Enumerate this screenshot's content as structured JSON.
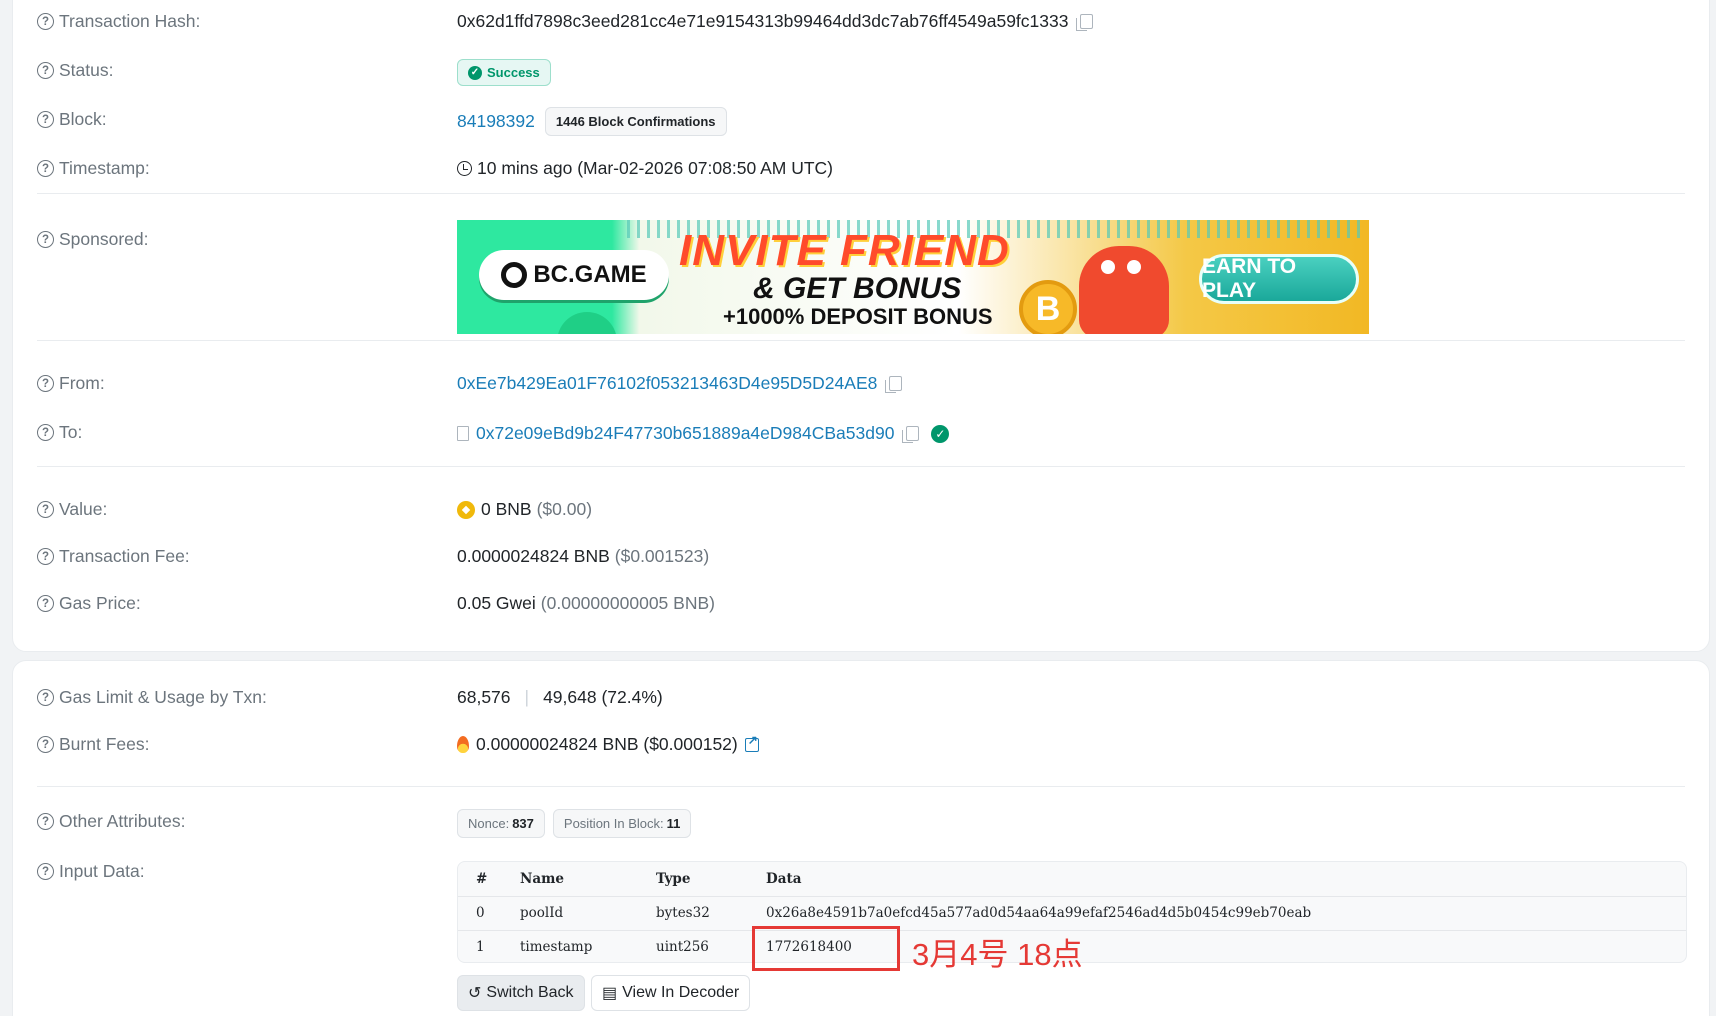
{
  "overview": {
    "tx_hash": {
      "label": "Transaction Hash:",
      "value": "0x62d1ffd7898c3eed281cc4e71e9154313b99464dd3dc7ab76ff4549a59fc1333"
    },
    "status": {
      "label": "Status:",
      "value": "Success"
    },
    "block": {
      "label": "Block:",
      "number": "84198392",
      "confirmations": "1446 Block Confirmations"
    },
    "timestamp": {
      "label": "Timestamp:",
      "value": "10 mins ago (Mar-02-2026 07:08:50 AM UTC)"
    },
    "sponsored": {
      "label": "Sponsored:",
      "banner": {
        "brand": "BC.GAME",
        "headline": "INVITE FRIEND",
        "subline": "& GET BONUS",
        "offer": "+1000% DEPOSIT BONUS",
        "cta": "EARN TO PLAY",
        "coin_symbol": "B"
      }
    },
    "from": {
      "label": "From:",
      "address": "0xEe7b429Ea01F76102f053213463D4e95D5D24AE8"
    },
    "to": {
      "label": "To:",
      "address": "0x72e09eBd9b24F47730b651889a4eD984CBa53d90"
    },
    "value": {
      "label": "Value:",
      "amount": "0 BNB",
      "usd": "($0.00)"
    },
    "fee": {
      "label": "Transaction Fee:",
      "amount": "0.0000024824 BNB",
      "usd": "($0.001523)"
    },
    "gas_price": {
      "label": "Gas Price:",
      "amount": "0.05 Gwei",
      "bnb": "(0.00000000005 BNB)"
    }
  },
  "more": {
    "gas_limit": {
      "label": "Gas Limit & Usage by Txn:",
      "limit": "68,576",
      "separator": "|",
      "usage": "49,648 (72.4%)"
    },
    "burnt": {
      "label": "Burnt Fees:",
      "amount": "0.00000024824 BNB ($0.000152)"
    },
    "other": {
      "label": "Other Attributes:",
      "nonce_key": "Nonce:",
      "nonce_val": "837",
      "pos_key": "Position In Block:",
      "pos_val": "11"
    },
    "input": {
      "label": "Input Data:",
      "headers": [
        "#",
        "Name",
        "Type",
        "Data"
      ],
      "rows": [
        [
          "0",
          "poolId",
          "bytes32",
          "0x26a8e4591b7a0efcd45a577ad0d54aa64a99efaf2546ad4d5b0454c99eb70eab"
        ],
        [
          "1",
          "timestamp",
          "uint256",
          "1772618400"
        ]
      ],
      "switch_back": "Switch Back",
      "view_decoder": "View In Decoder"
    }
  },
  "annotation": {
    "text": "3月4号 18点",
    "color": "#e53935"
  },
  "colors": {
    "link": "#1a7db8",
    "success": "#00966b",
    "muted": "#6c757d"
  }
}
